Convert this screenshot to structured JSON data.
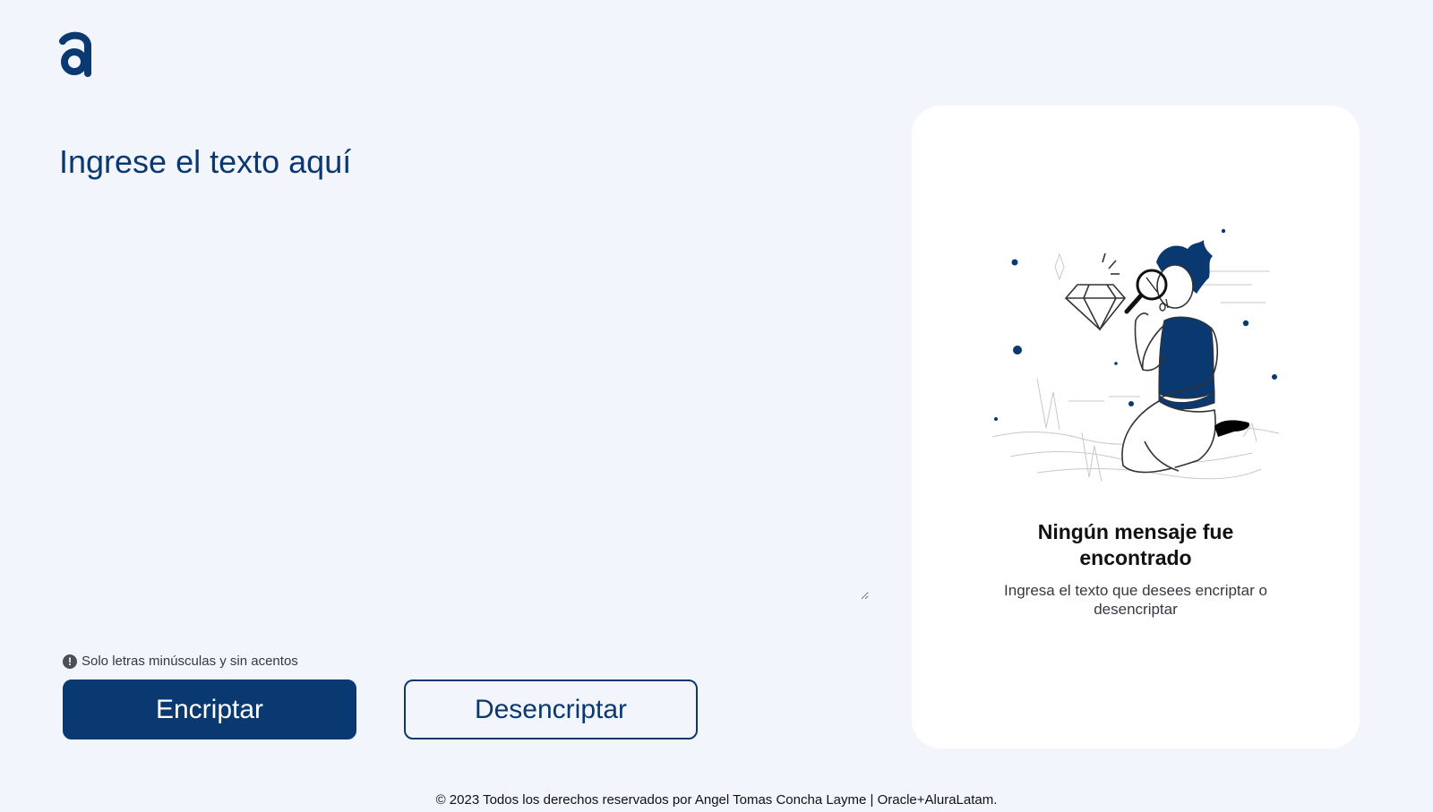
{
  "brand": {
    "logo_icon": "alura-logo-icon",
    "accent_color": "#0a3871"
  },
  "input": {
    "placeholder": "Ingrese el texto aquí",
    "value": ""
  },
  "note": {
    "icon": "exclamation-circle-icon",
    "text": "Solo letras minúsculas y sin acentos"
  },
  "buttons": {
    "encrypt_label": "Encriptar",
    "decrypt_label": "Desencriptar"
  },
  "output_panel": {
    "illustration": "person-with-magnifier-illustration",
    "title": "Ningún mensaje fue encontrado",
    "subtitle": "Ingresa el texto que desees encriptar o desencriptar"
  },
  "footer": {
    "text": "© 2023 Todos los derechos reservados por Angel Tomas Concha Layme | Oracle+AluraLatam."
  }
}
